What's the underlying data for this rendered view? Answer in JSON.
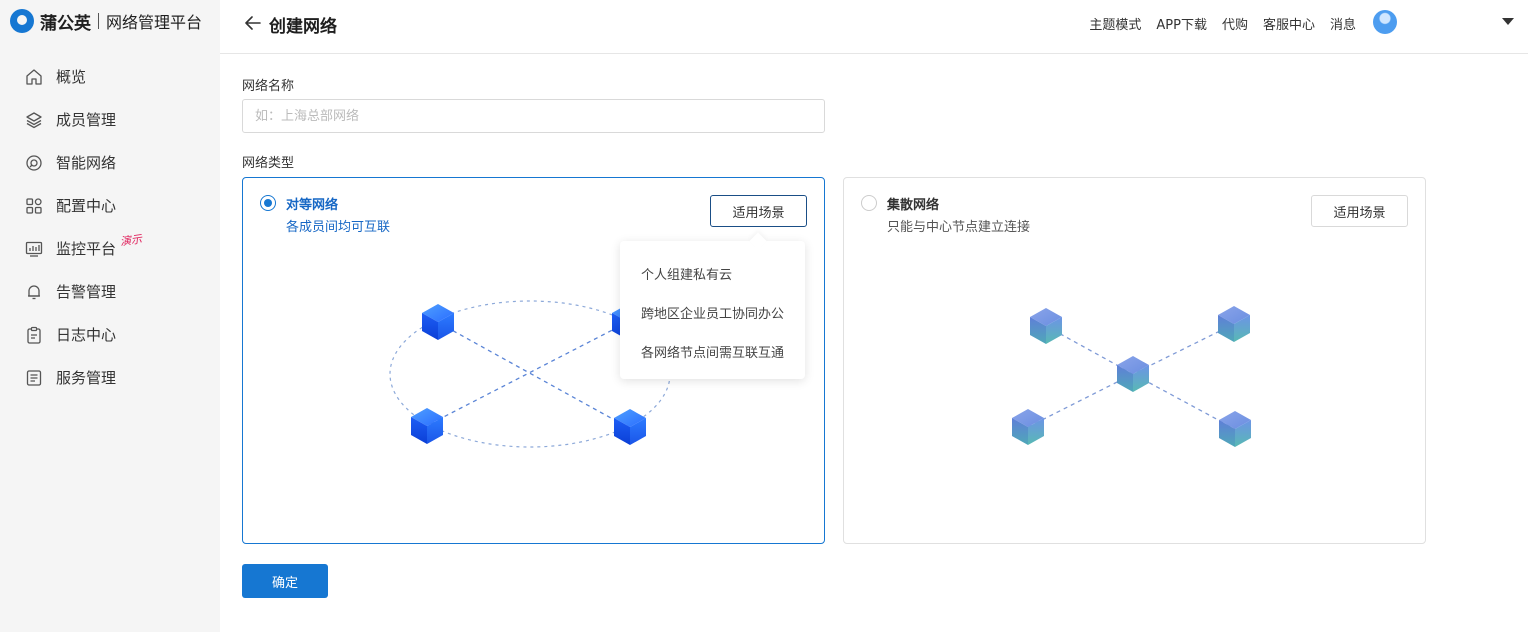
{
  "brand": {
    "name": "蒲公英",
    "subtitle": "网络管理平台"
  },
  "sidebar": {
    "items": [
      {
        "label": "概览",
        "icon": "home-icon"
      },
      {
        "label": "成员管理",
        "icon": "layers-icon"
      },
      {
        "label": "智能网络",
        "icon": "network-icon"
      },
      {
        "label": "配置中心",
        "icon": "apps-grid-icon"
      },
      {
        "label": "监控平台",
        "icon": "monitor-icon",
        "badge": "演示"
      },
      {
        "label": "告警管理",
        "icon": "bell-icon"
      },
      {
        "label": "日志中心",
        "icon": "clipboard-icon"
      },
      {
        "label": "服务管理",
        "icon": "document-list-icon"
      }
    ]
  },
  "header": {
    "title": "创建网络",
    "links": [
      "主题模式",
      "APP下载",
      "代购",
      "客服中心",
      "消息"
    ]
  },
  "form": {
    "name_label": "网络名称",
    "name_value": "",
    "name_placeholder": "如：上海总部网络",
    "type_label": "网络类型",
    "options": [
      {
        "title": "对等网络",
        "desc": "各成员间均可互联",
        "scene_label": "适用场景",
        "selected": true
      },
      {
        "title": "集散网络",
        "desc": "只能与中心节点建立连接",
        "scene_label": "适用场景",
        "selected": false
      }
    ],
    "scene_popover": [
      "个人组建私有云",
      "跨地区企业员工协同办公",
      "各网络节点间需互联互通"
    ],
    "confirm_label": "确定"
  },
  "colors": {
    "primary": "#1677d2",
    "badge": "#e0245e",
    "sidebar_bg": "#f5f5f5"
  }
}
